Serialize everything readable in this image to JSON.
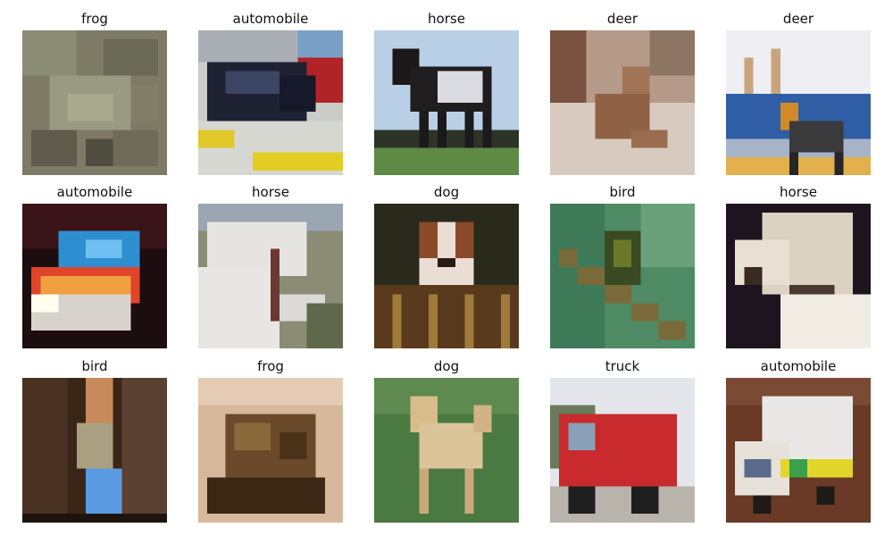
{
  "images": [
    {
      "label": "frog"
    },
    {
      "label": "automobile"
    },
    {
      "label": "horse"
    },
    {
      "label": "deer"
    },
    {
      "label": "deer"
    },
    {
      "label": "automobile"
    },
    {
      "label": "horse"
    },
    {
      "label": "dog"
    },
    {
      "label": "bird"
    },
    {
      "label": "horse"
    },
    {
      "label": "bird"
    },
    {
      "label": "frog"
    },
    {
      "label": "dog"
    },
    {
      "label": "truck"
    },
    {
      "label": "automobile"
    }
  ]
}
